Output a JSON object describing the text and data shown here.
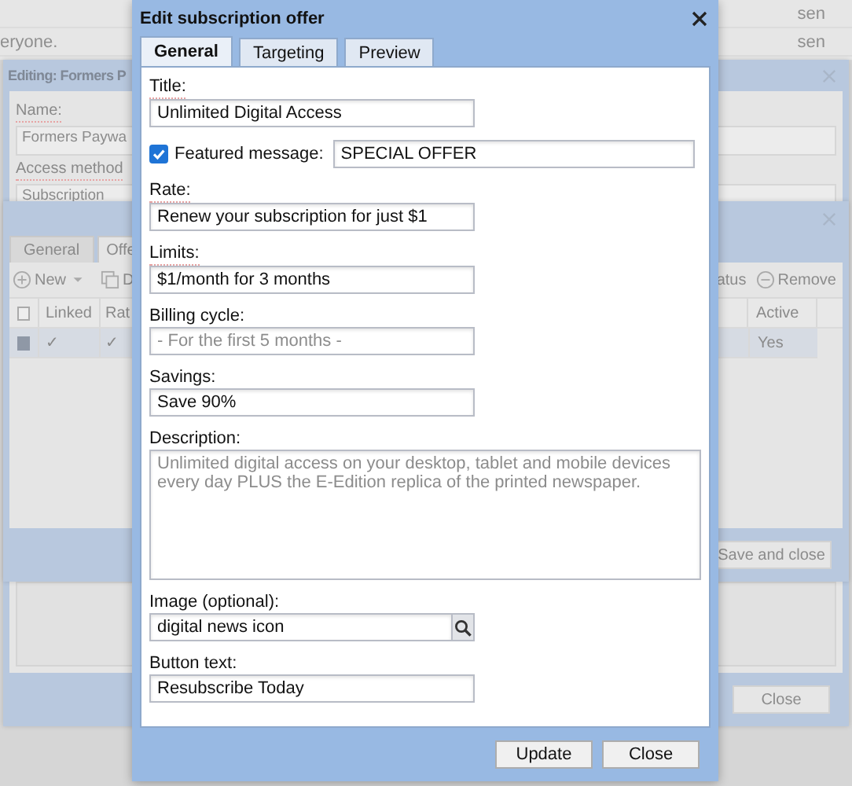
{
  "background_list": {
    "rows": [
      {
        "column_2": "sen"
      },
      {
        "column_1": "eryone.",
        "column_2": "sen"
      }
    ]
  },
  "offer_editor": {
    "title": "Editing: Formers P",
    "fields": [
      {
        "label": "Name:",
        "value": "Formers Paywa",
        "required": true
      },
      {
        "label": "Access method",
        "value": "Subscription",
        "required": true
      }
    ],
    "buttons": [
      "Close"
    ]
  },
  "offers_window": {
    "tabs": [
      {
        "label": "General",
        "selected": false
      },
      {
        "label": "Offe",
        "selected": true
      }
    ],
    "toolbar_left": [
      {
        "label": "New",
        "kind": "new"
      },
      {
        "label": "D",
        "kind": "copy"
      }
    ],
    "toolbar_right": [
      {
        "label": "atus",
        "kind": "plain"
      },
      {
        "label": "Remove",
        "kind": "remove"
      }
    ],
    "select_all_checked": false,
    "columns_left": [
      "Linked",
      "Rat"
    ],
    "columns_right": [
      "Active"
    ],
    "rows": [
      {
        "checked": true,
        "left": [
          "✓",
          "✓"
        ],
        "right": [
          "Yes"
        ]
      }
    ],
    "buttons": [
      "Save and close"
    ]
  },
  "dialog": {
    "title": "Edit subscription offer",
    "tabs": [
      {
        "label": "General",
        "selected": true
      },
      {
        "label": "Targeting",
        "selected": false
      },
      {
        "label": "Preview",
        "selected": false
      }
    ],
    "fields": [
      {
        "kind": "text",
        "label": "Title:",
        "required": true,
        "value": "Unlimited Digital Access"
      },
      {
        "kind": "check_text",
        "label": "Featured message:",
        "checked": true,
        "value": "SPECIAL OFFER"
      },
      {
        "kind": "text",
        "label": "Rate:",
        "required": true,
        "value": "Renew your subscription for just $1"
      },
      {
        "kind": "text",
        "label": "Limits:",
        "required": true,
        "value": "$1/month for 3 months"
      },
      {
        "kind": "text",
        "label": "Billing cycle:",
        "required": false,
        "placeholder": "- For the first 5 months -"
      },
      {
        "kind": "text",
        "label": "Savings:",
        "required": false,
        "value": "Save 90%"
      },
      {
        "kind": "textarea",
        "label": "Description:",
        "required": false,
        "placeholder": "Unlimited digital access on your desktop, tablet and mobile devices every day PLUS the E-Edition replica of the printed newspaper."
      },
      {
        "kind": "search",
        "label": "Image (optional):",
        "required": false,
        "value": "digital news icon"
      },
      {
        "kind": "text",
        "label": "Button text:",
        "required": false,
        "value": "Resubscribe Today"
      }
    ],
    "buttons": [
      "Update",
      "Close"
    ]
  }
}
